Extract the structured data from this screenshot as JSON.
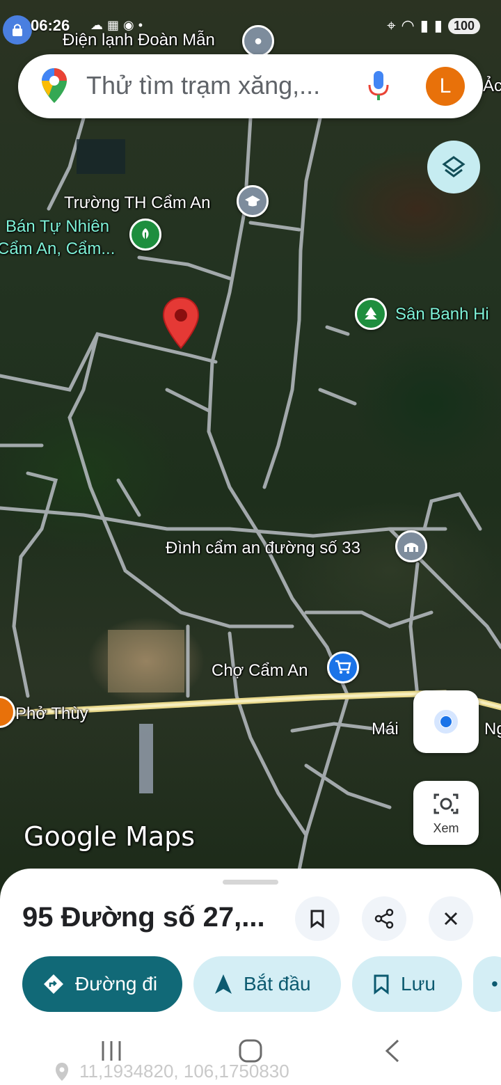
{
  "status_bar": {
    "time": "06:26",
    "battery": "100"
  },
  "search": {
    "placeholder": "Thử tìm trạm xăng,...",
    "avatar_letter": "L"
  },
  "map": {
    "labels": {
      "top": "Điện lạnh Đoàn Mẫn",
      "school": "Trường TH Cẩm An",
      "nature_1": "Bán Tự Nhiên",
      "nature_2": "Cẩm An, Cẩm...",
      "field": "Sân Banh Hi",
      "temple": "Đình cẩm an đường số 33",
      "market": "Chợ Cẩm An",
      "pho": "Phở Thùy",
      "right_1": "Mái",
      "right_2": "Ng",
      "top_right": "Ảc"
    },
    "lens_label": "Xem",
    "watermark": "Google Maps"
  },
  "sheet": {
    "title": "95 Đường số 27,...",
    "chips": {
      "directions": "Đường đi",
      "start": "Bắt đầu",
      "save": "Lưu"
    },
    "coordinates": "11,1934820, 106,1750830"
  },
  "colors": {
    "primary": "#116977",
    "secondary_chip": "#d4eef5",
    "pin_red": "#e53935",
    "poi_gray": "#7d8c9c",
    "poi_green": "#1e8e3e",
    "poi_blue": "#1a73e8"
  }
}
